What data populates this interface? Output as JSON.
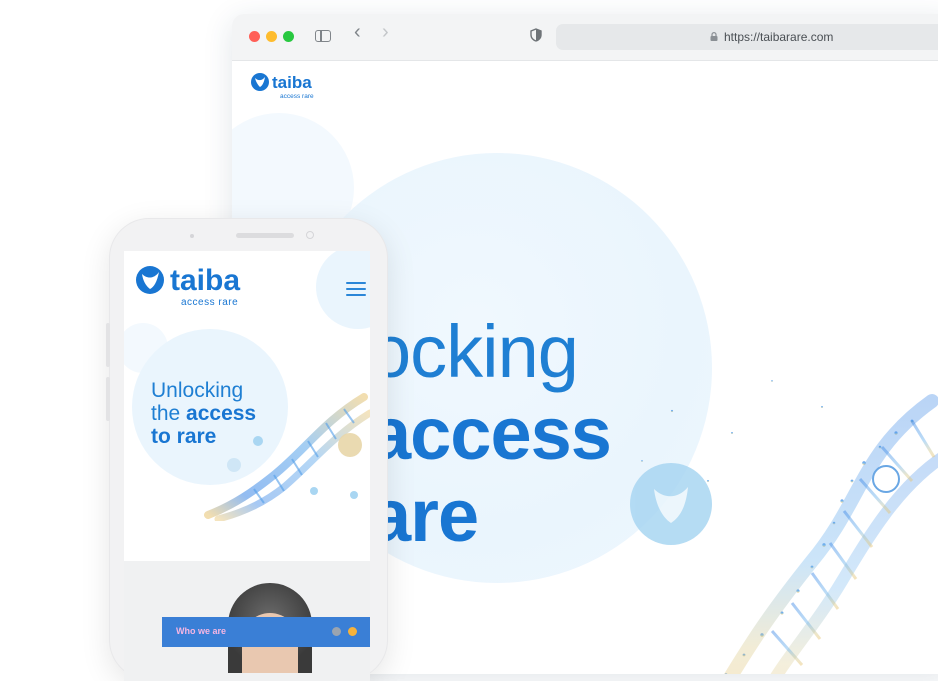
{
  "browser": {
    "url": "https://taibarare.com",
    "nav": {
      "back": "‹",
      "forward": "›"
    }
  },
  "brand": {
    "name": "taiba",
    "tagline_desktop": "access rare",
    "tagline_mobile": "access rare",
    "primary_color": "#1976d2",
    "accent_color": "#f5b23c"
  },
  "desktop_hero": {
    "line1": "ocking",
    "line2": "access",
    "line3": "are"
  },
  "mobile_hero": {
    "line1": "Unlocking",
    "line2_prefix": "the ",
    "line2_bold": "access",
    "line3": "to rare"
  },
  "mobile_section": {
    "label": "Who we are"
  }
}
